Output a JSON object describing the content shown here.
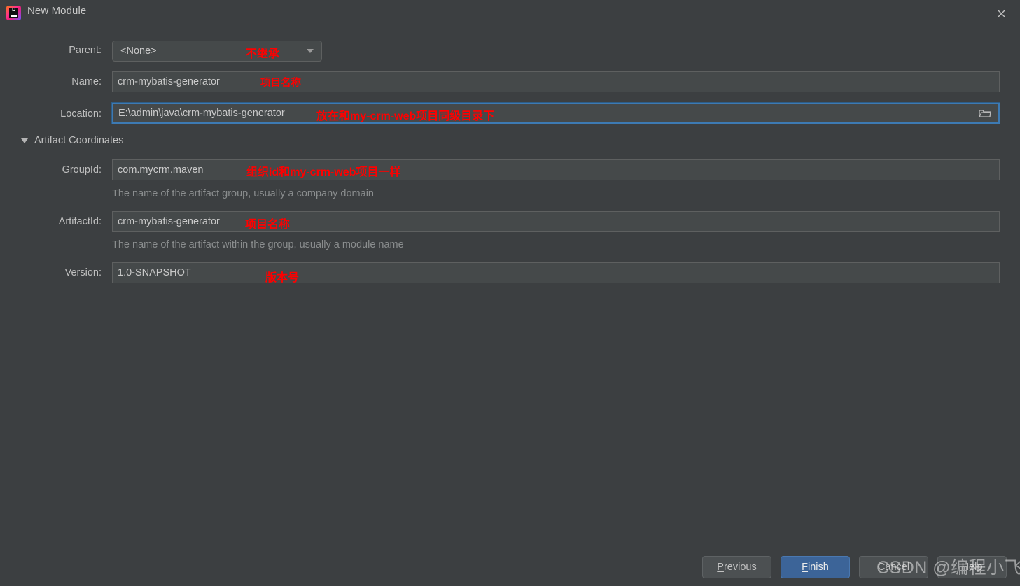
{
  "window": {
    "title": "New Module",
    "logo_icon": "intellij-idea-icon",
    "close_icon": "close-icon"
  },
  "form": {
    "parent": {
      "label": "Parent:",
      "value": "<None>",
      "annotation": "不继承",
      "dropdown_icon": "chevron-down-icon"
    },
    "name": {
      "label": "Name:",
      "value": "crm-mybatis-generator",
      "annotation": "项目名称"
    },
    "location": {
      "label": "Location:",
      "value": "E:\\admin\\java\\crm-mybatis-generator",
      "annotation": "放在和my-crm-web项目同级目录下",
      "browse_icon": "folder-icon",
      "focused": true
    }
  },
  "artifact_section": {
    "title": "Artifact Coordinates",
    "collapse_icon": "triangle-down-icon",
    "group_id": {
      "label": "GroupId:",
      "value": "com.mycrm.maven",
      "annotation": "组织id和my-crm-web项目一样",
      "hint": "The name of the artifact group, usually a company domain"
    },
    "artifact_id": {
      "label": "ArtifactId:",
      "value": "crm-mybatis-generator",
      "annotation": "项目名称",
      "hint": "The name of the artifact within the group, usually a module name"
    },
    "version": {
      "label": "Version:",
      "value": "1.0-SNAPSHOT",
      "annotation": "版本号"
    }
  },
  "buttons": {
    "previous": "Previous",
    "previous_mnemonic": "P",
    "finish": "Finish",
    "finish_mnemonic": "F",
    "cancel": "Cancel",
    "help": "Help"
  },
  "watermark": {
    "text": "CSDN @编程小飞侠"
  },
  "colors": {
    "background": "#3c3f41",
    "field_background": "#45494a",
    "accent_blue": "#3c6498",
    "focus_border": "#3d7ab3",
    "annotation_red": "#ff0000",
    "text": "#bfbfbf",
    "hint_text": "#8a8d8e"
  }
}
